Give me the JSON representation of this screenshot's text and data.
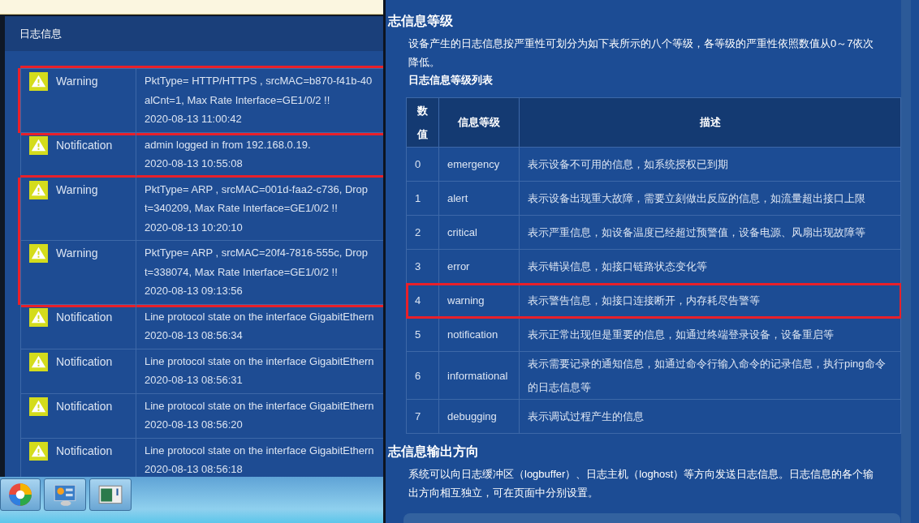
{
  "log_panel": {
    "title": "日志信息",
    "rows": [
      {
        "level": "Warning",
        "lines": [
          "PktType= HTTP/HTTPS , srcMAC=b870-f41b-40",
          "alCnt=1, Max Rate Interface=GE1/0/2 !!"
        ],
        "time": "2020-08-13 11:00:42",
        "highlighted": true
      },
      {
        "level": "Notification",
        "lines": [
          "admin logged in from 192.168.0.19."
        ],
        "time": "2020-08-13 10:55:08",
        "highlighted": false
      },
      {
        "level": "Warning",
        "lines": [
          "PktType= ARP , srcMAC=001d-faa2-c736, Drop",
          "t=340209, Max Rate Interface=GE1/0/2 !!"
        ],
        "time": "2020-08-13 10:20:10",
        "highlighted": true
      },
      {
        "level": "Warning",
        "lines": [
          "PktType= ARP , srcMAC=20f4-7816-555c, Drop",
          "t=338074, Max Rate Interface=GE1/0/2 !!"
        ],
        "time": "2020-08-13 09:13:56",
        "highlighted": true
      },
      {
        "level": "Notification",
        "lines": [
          "Line protocol state on the interface GigabitEthern"
        ],
        "time": "2020-08-13 08:56:34",
        "highlighted": false
      },
      {
        "level": "Notification",
        "lines": [
          "Line protocol state on the interface GigabitEthern"
        ],
        "time": "2020-08-13 08:56:31",
        "highlighted": false
      },
      {
        "level": "Notification",
        "lines": [
          "Line protocol state on the interface GigabitEthern"
        ],
        "time": "2020-08-13 08:56:20",
        "highlighted": false
      },
      {
        "level": "Notification",
        "lines": [
          "Line protocol state on the interface GigabitEthern"
        ],
        "time": "2020-08-13 08:56:18",
        "highlighted": false
      }
    ]
  },
  "help": {
    "section_1": {
      "heading": "志信息等级",
      "text": "设备产生的日志信息按严重性可划分为如下表所示的八个等级，各等级的严重性依照数值从0～7依次降低。",
      "table_title": "日志信息等级列表"
    },
    "table": {
      "columns": [
        "数值",
        "信息等级",
        "描述"
      ],
      "rows": [
        {
          "value": "0",
          "level": "emergency",
          "description": "表示设备不可用的信息，如系统授权已到期",
          "highlighted": false
        },
        {
          "value": "1",
          "level": "alert",
          "description": "表示设备出现重大故障，需要立刻做出反应的信息，如流量超出接口上限",
          "highlighted": false
        },
        {
          "value": "2",
          "level": "critical",
          "description": "表示严重信息，如设备温度已经超过预警值，设备电源、风扇出现故障等",
          "highlighted": false
        },
        {
          "value": "3",
          "level": "error",
          "description": "表示错误信息，如接口链路状态变化等",
          "highlighted": false
        },
        {
          "value": "4",
          "level": "warning",
          "description": "表示警告信息，如接口连接断开，内存耗尽告警等",
          "highlighted": true
        },
        {
          "value": "5",
          "level": "notification",
          "description": "表示正常出现但是重要的信息，如通过终端登录设备，设备重启等",
          "highlighted": false
        },
        {
          "value": "6",
          "level": "informational",
          "description": "表示需要记录的通知信息，如通过命令行输入命令的记录信息，执行ping命令的日志信息等",
          "highlighted": false
        },
        {
          "value": "7",
          "level": "debugging",
          "description": "表示调试过程产生的信息",
          "highlighted": false
        }
      ]
    },
    "section_2": {
      "heading": "志信息输出方向",
      "text": "系统可以向日志缓冲区（logbuffer）、日志主机（loghost）等方向发送日志信息。日志信息的各个输出方向相互独立，可在页面中分别设置。"
    }
  }
}
